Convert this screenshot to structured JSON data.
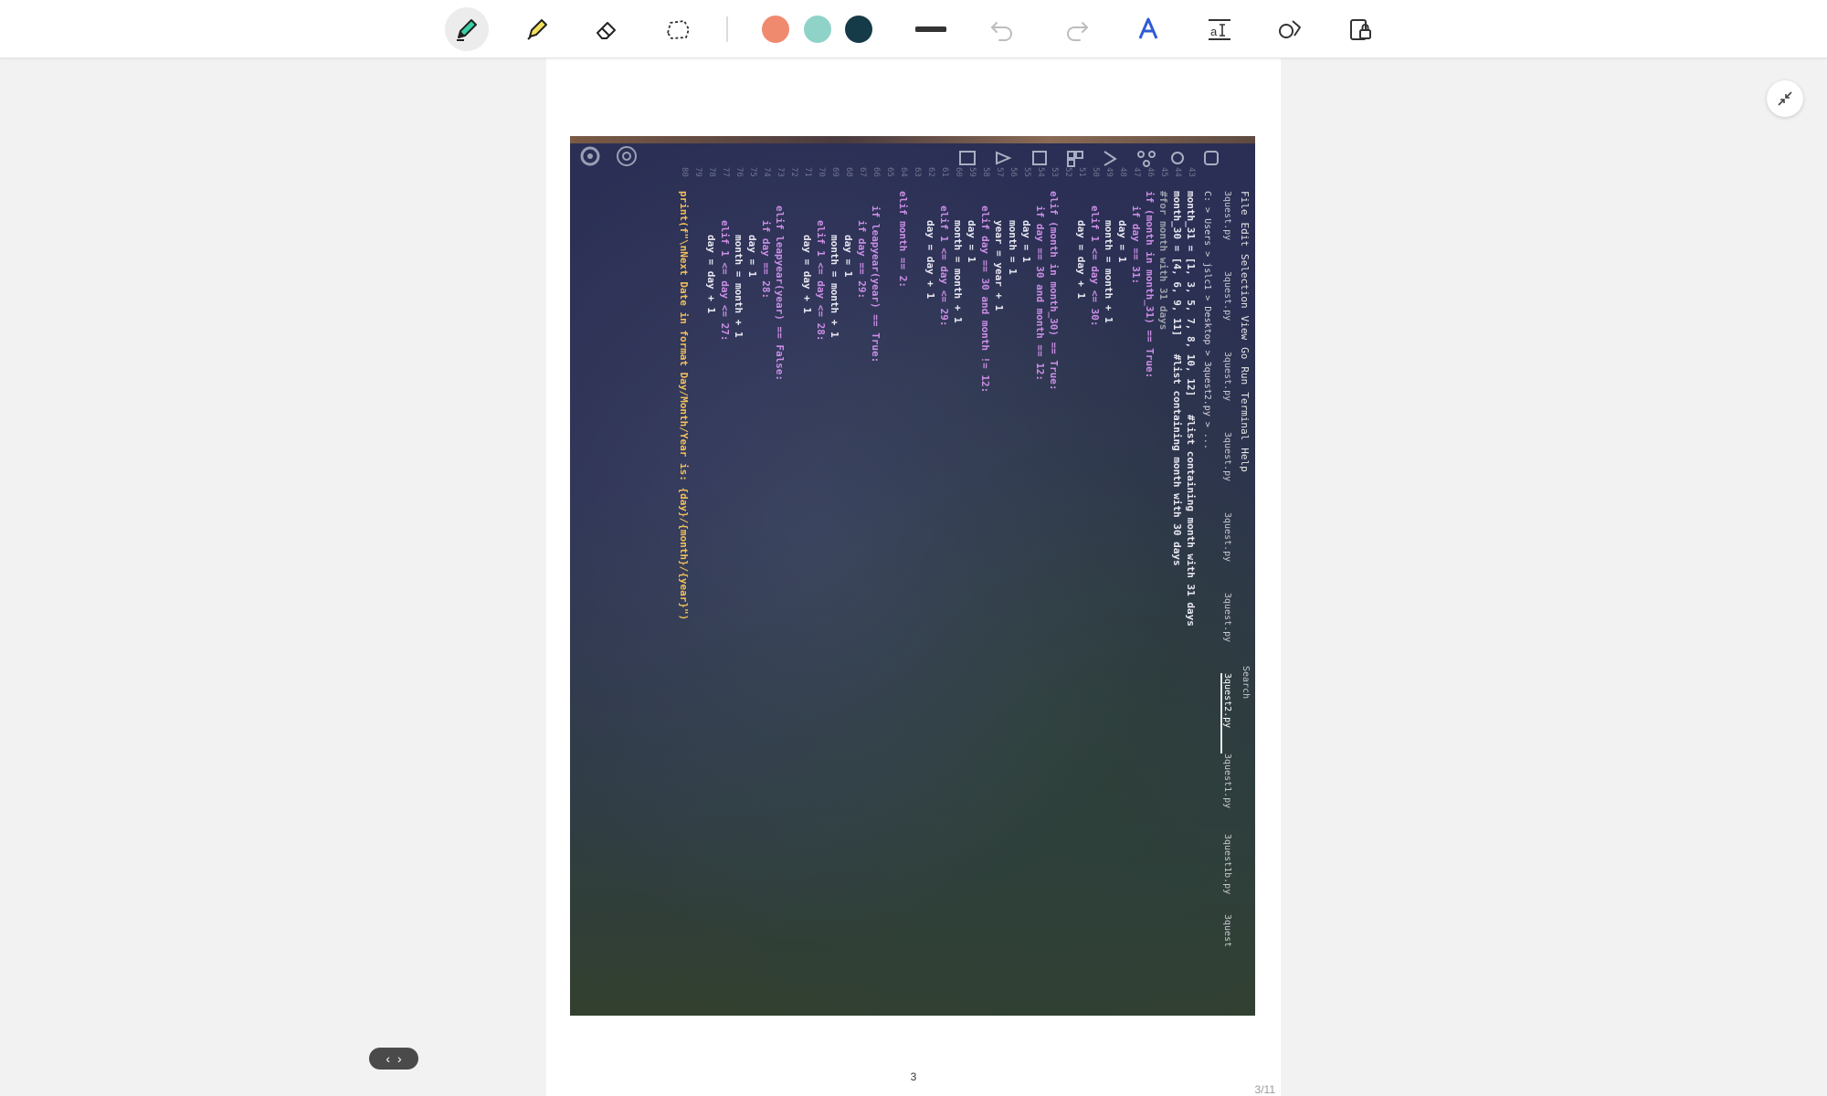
{
  "toolbar": {
    "tools": [
      "pen-tool",
      "highlighter-tool",
      "eraser-tool",
      "lasso-tool"
    ],
    "colors": [
      "#f08a6e",
      "#8fd3c8",
      "#153a48"
    ],
    "undo_icon": "undo-icon",
    "redo_icon": "redo-icon",
    "extra_tools": [
      "text-style-tool",
      "text-insert-tool",
      "shapes-tool",
      "lock-tool"
    ]
  },
  "photo": {
    "menu": [
      "File",
      "Edit",
      "Selection",
      "View",
      "Go",
      "Run",
      "Terminal",
      "Help"
    ],
    "tabs": [
      "3quest.py",
      "3quest.py",
      "3quest.py",
      "3quest.py",
      "3quest.py",
      "3quest.py",
      "3quest2.py",
      "3quest1.py",
      "3quest1b.py",
      "3quest"
    ],
    "search_label": "Search",
    "path": "C: > Users > jslc1 > Desktop > 3quest2.py > ...",
    "line_numbers": [
      "43",
      "44",
      "45",
      "46",
      "47",
      "48",
      "49",
      "50",
      "51",
      "52",
      "53",
      "54",
      "55",
      "56",
      "57",
      "58",
      "59",
      "60",
      "61",
      "62",
      "63",
      "64",
      "65",
      "66",
      "67",
      "68",
      "69",
      "70",
      "71",
      "72",
      "73",
      "74",
      "75",
      "76",
      "77",
      "78",
      "79",
      "80"
    ],
    "code_lines": [
      {
        "indent": 0,
        "cls": "tx",
        "text": "month_31 = [1, 3, 5, 7, 8, 10, 12]   #list containing month with 31 days"
      },
      {
        "indent": 0,
        "cls": "tx",
        "text": "month_30 = [4, 6, 9, 11]   #list containing month with 30 days"
      },
      {
        "indent": 0,
        "cls": "cm",
        "text": "#for month with 31 days"
      },
      {
        "indent": 0,
        "cls": "kw",
        "text": "if (month in month_31) == True:"
      },
      {
        "indent": 1,
        "cls": "kw",
        "text": "if day == 31:"
      },
      {
        "indent": 2,
        "cls": "tx",
        "text": "day = 1"
      },
      {
        "indent": 2,
        "cls": "tx",
        "text": "month = month + 1"
      },
      {
        "indent": 1,
        "cls": "kw",
        "text": "elif 1 <= day <= 30:"
      },
      {
        "indent": 2,
        "cls": "tx",
        "text": "day = day + 1"
      },
      {
        "indent": 0,
        "cls": "tx",
        "text": ""
      },
      {
        "indent": 0,
        "cls": "kw",
        "text": "elif (month in month_30) == True:"
      },
      {
        "indent": 1,
        "cls": "kw",
        "text": "if day == 30 and month == 12:"
      },
      {
        "indent": 2,
        "cls": "tx",
        "text": "day = 1"
      },
      {
        "indent": 2,
        "cls": "tx",
        "text": "month = 1"
      },
      {
        "indent": 2,
        "cls": "tx",
        "text": "year = year + 1"
      },
      {
        "indent": 1,
        "cls": "kw",
        "text": "elif day == 30 and month != 12:"
      },
      {
        "indent": 2,
        "cls": "tx",
        "text": "day = 1"
      },
      {
        "indent": 2,
        "cls": "tx",
        "text": "month = month + 1"
      },
      {
        "indent": 1,
        "cls": "kw",
        "text": "elif 1 <= day <= 29:"
      },
      {
        "indent": 2,
        "cls": "tx",
        "text": "day = day + 1"
      },
      {
        "indent": 0,
        "cls": "tx",
        "text": ""
      },
      {
        "indent": 0,
        "cls": "kw",
        "text": "elif month == 2:"
      },
      {
        "indent": 0,
        "cls": "tx",
        "text": ""
      },
      {
        "indent": 1,
        "cls": "kw",
        "text": "if leapyear(year) == True:"
      },
      {
        "indent": 2,
        "cls": "kw",
        "text": "if day == 29:"
      },
      {
        "indent": 3,
        "cls": "tx",
        "text": "day = 1"
      },
      {
        "indent": 3,
        "cls": "tx",
        "text": "month = month + 1"
      },
      {
        "indent": 2,
        "cls": "kw",
        "text": "elif 1 <= day <= 28:"
      },
      {
        "indent": 3,
        "cls": "tx",
        "text": "day = day + 1"
      },
      {
        "indent": 0,
        "cls": "tx",
        "text": ""
      },
      {
        "indent": 1,
        "cls": "kw",
        "text": "elif leapyear(year) == False:"
      },
      {
        "indent": 2,
        "cls": "kw",
        "text": "if day == 28:"
      },
      {
        "indent": 3,
        "cls": "tx",
        "text": "day = 1"
      },
      {
        "indent": 3,
        "cls": "tx",
        "text": "month = month + 1"
      },
      {
        "indent": 2,
        "cls": "kw",
        "text": "elif 1 <= day <= 27:"
      },
      {
        "indent": 3,
        "cls": "tx",
        "text": "day = day + 1"
      },
      {
        "indent": 0,
        "cls": "tx",
        "text": ""
      },
      {
        "indent": 0,
        "cls": "pr",
        "text": "print(f\"\\nNext Date in format Day/Month/Year is: {day}/{month}/{year}\")"
      }
    ]
  },
  "page": {
    "number": "3",
    "counter": "3/11"
  },
  "pager": {
    "prev": "‹",
    "next": "›"
  }
}
